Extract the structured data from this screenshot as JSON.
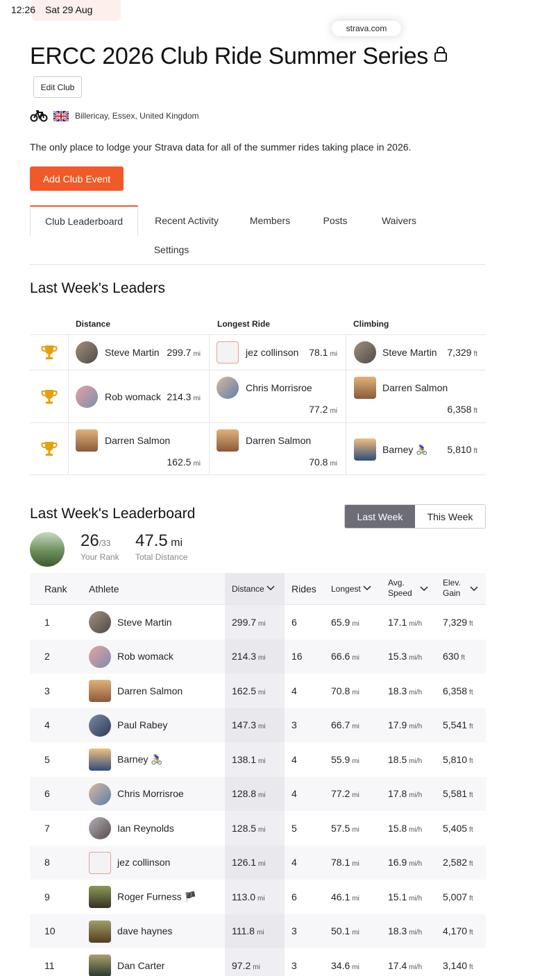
{
  "status": {
    "time": "12:26",
    "date": "Sat 29 Aug"
  },
  "browser": {
    "url": "strava.com"
  },
  "club": {
    "title": "ERCC 2026 Club Ride Summer Series",
    "edit_label": "Edit Club",
    "location": "Billericay, Essex, United Kingdom",
    "description": "The only place to lodge your Strava data for all of the summer rides taking place in 2026.",
    "add_event_label": "Add Club Event"
  },
  "tabs": [
    "Club Leaderboard",
    "Recent Activity",
    "Members",
    "Posts",
    "Waivers",
    "Settings"
  ],
  "leaders": {
    "title": "Last Week's Leaders",
    "columns": [
      "Distance",
      "Longest Ride",
      "Climbing"
    ],
    "rows": [
      {
        "distance": {
          "name": "Steve Martin",
          "value": "299.7",
          "unit": "mi"
        },
        "longest": {
          "name": "jez collinson",
          "value": "78.1",
          "unit": "mi"
        },
        "climbing": {
          "name": "Steve Martin",
          "value": "7,329",
          "unit": "ft"
        }
      },
      {
        "distance": {
          "name": "Rob womack",
          "value": "214.3",
          "unit": "mi"
        },
        "longest": {
          "name": "Chris Morrisroe",
          "value": "77.2",
          "unit": "mi"
        },
        "climbing": {
          "name": "Darren Salmon",
          "value": "6,358",
          "unit": "ft"
        }
      },
      {
        "distance": {
          "name": "Darren Salmon",
          "value": "162.5",
          "unit": "mi"
        },
        "longest": {
          "name": "Darren Salmon",
          "value": "70.8",
          "unit": "mi"
        },
        "climbing": {
          "name": "Barney 🚴🏽‍♀️",
          "value": "5,810",
          "unit": "ft"
        }
      }
    ]
  },
  "leaderboard": {
    "title": "Last Week's Leaderboard",
    "toggle": {
      "active": "Last Week",
      "inactive": "This Week"
    },
    "my_rank": {
      "rank": "26",
      "of": "/33",
      "rank_label": "Your Rank",
      "distance": "47.5",
      "distance_unit": "mi",
      "distance_label": "Total Distance"
    },
    "headers": {
      "rank": "Rank",
      "athlete": "Athlete",
      "distance": "Distance",
      "rides": "Rides",
      "longest": "Longest",
      "avg_speed_1": "Avg.",
      "avg_speed_2": "Speed",
      "elev_1": "Elev.",
      "elev_2": "Gain"
    },
    "rows": [
      {
        "rank": "1",
        "athlete": "Steve Martin",
        "distance": "299.7",
        "rides": "6",
        "longest": "65.9",
        "speed": "17.1",
        "elev": "7,329"
      },
      {
        "rank": "2",
        "athlete": "Rob womack",
        "distance": "214.3",
        "rides": "16",
        "longest": "66.6",
        "speed": "15.3",
        "elev": "630"
      },
      {
        "rank": "3",
        "athlete": "Darren Salmon",
        "distance": "162.5",
        "rides": "4",
        "longest": "70.8",
        "speed": "18.3",
        "elev": "6,358"
      },
      {
        "rank": "4",
        "athlete": "Paul Rabey",
        "distance": "147.3",
        "rides": "3",
        "longest": "66.7",
        "speed": "17.9",
        "elev": "5,541"
      },
      {
        "rank": "5",
        "athlete": "Barney 🚴🏽‍♀️",
        "distance": "138.1",
        "rides": "4",
        "longest": "55.9",
        "speed": "18.5",
        "elev": "5,810"
      },
      {
        "rank": "6",
        "athlete": "Chris Morrisroe",
        "distance": "128.8",
        "rides": "4",
        "longest": "77.2",
        "speed": "17.8",
        "elev": "5,581"
      },
      {
        "rank": "7",
        "athlete": "Ian Reynolds",
        "distance": "128.5",
        "rides": "5",
        "longest": "57.5",
        "speed": "15.8",
        "elev": "5,405"
      },
      {
        "rank": "8",
        "athlete": "jez collinson",
        "distance": "126.1",
        "rides": "4",
        "longest": "78.1",
        "speed": "16.9",
        "elev": "2,582"
      },
      {
        "rank": "9",
        "athlete": "Roger Furness 🏴",
        "distance": "113.0",
        "rides": "6",
        "longest": "46.1",
        "speed": "15.1",
        "elev": "5,007"
      },
      {
        "rank": "10",
        "athlete": "dave haynes",
        "distance": "111.8",
        "rides": "3",
        "longest": "50.1",
        "speed": "18.3",
        "elev": "4,170"
      },
      {
        "rank": "11",
        "athlete": "Dan Carter",
        "distance": "97.2",
        "rides": "3",
        "longest": "34.6",
        "speed": "17.4",
        "elev": "3,140"
      }
    ],
    "units": {
      "distance": "mi",
      "speed": "mi/h",
      "elev": "ft"
    }
  },
  "colors": {
    "accent": "#f05a28",
    "toggle_active": "#6d6d78",
    "trophy": "#e5a00d"
  }
}
